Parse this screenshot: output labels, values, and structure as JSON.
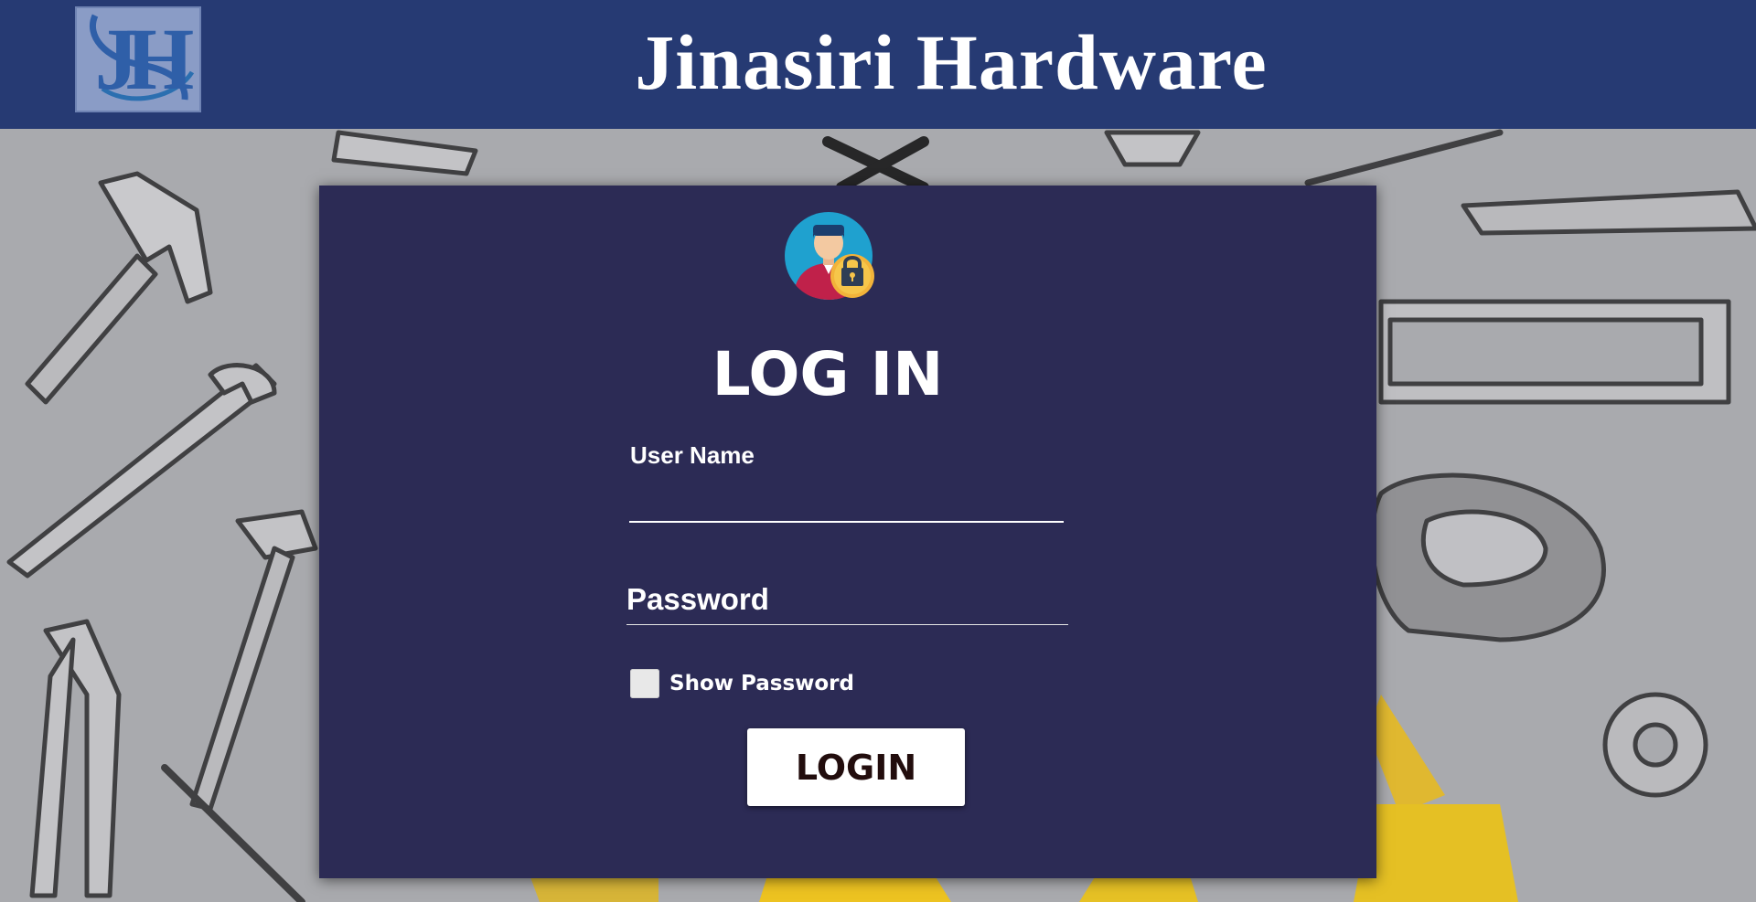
{
  "header": {
    "logo_text": "JH",
    "title": "Jinasiri Hardware"
  },
  "login_form": {
    "title": "LOG IN",
    "username_label": "User Name",
    "username_value": "",
    "password_placeholder": "Password",
    "password_value": "",
    "show_password_label": "Show Password",
    "show_password_checked": false,
    "login_button_label": "LOGIN"
  },
  "icons": {
    "logo": "jh-monogram-logo",
    "avatar": "user-lock-icon",
    "background": "hardware-tools-sketch"
  },
  "colors": {
    "header_bg": "#263a73",
    "card_bg": "#2c2b55",
    "page_bg": "#a9aaae",
    "button_bg": "#ffffff",
    "button_text": "#220d0d"
  }
}
